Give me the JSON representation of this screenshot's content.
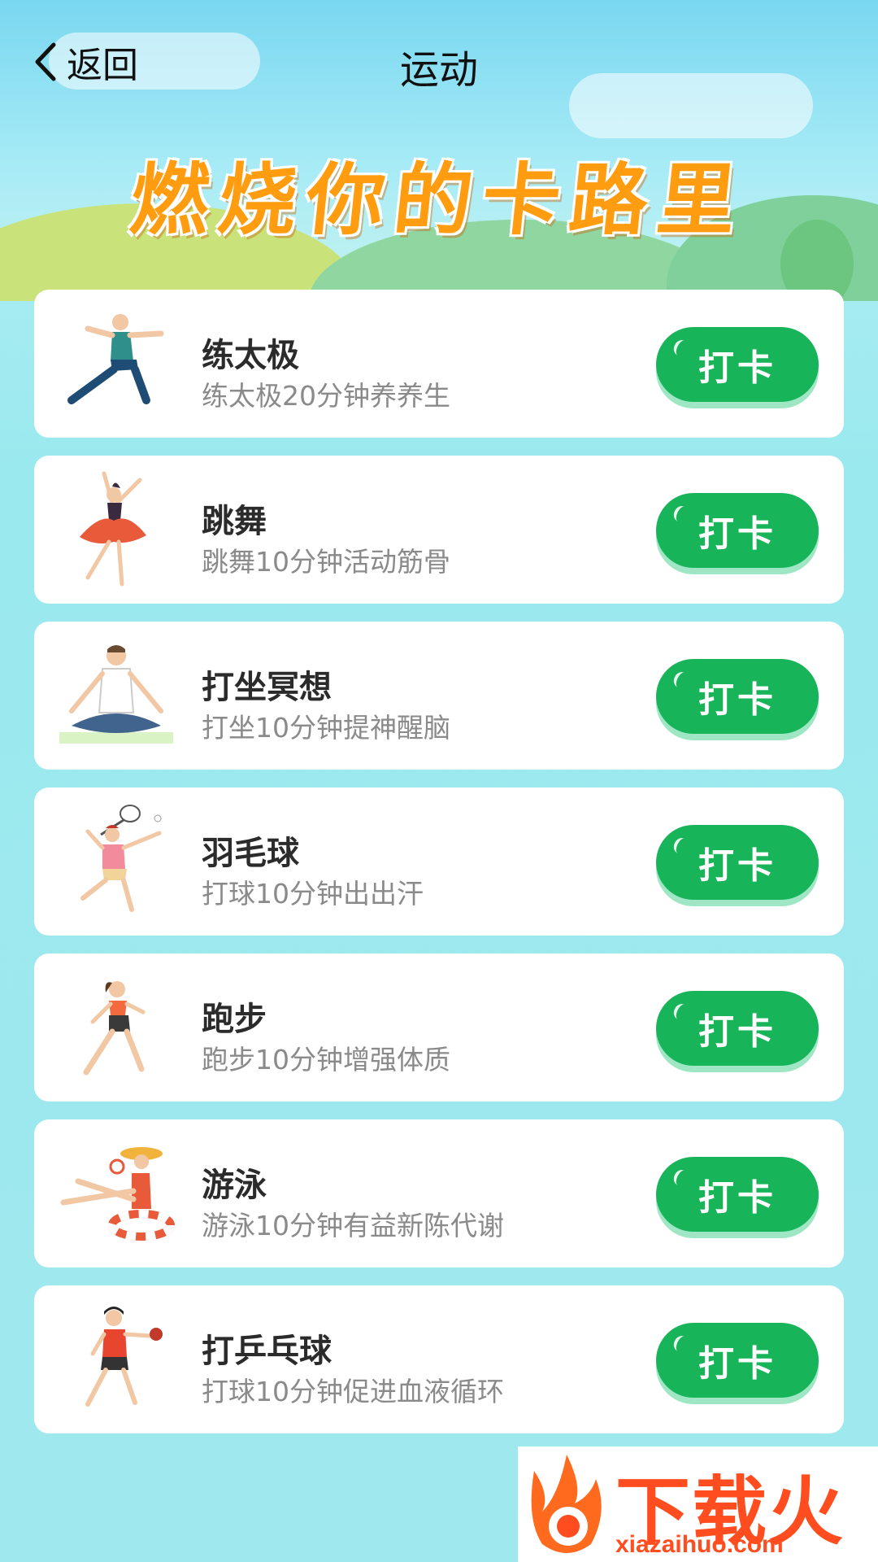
{
  "nav": {
    "back_label": "返回",
    "title": "运动"
  },
  "hero": {
    "headline": "燃烧你的卡路里"
  },
  "items": [
    {
      "title": "练太极",
      "desc": "练太极20分钟养养生",
      "button": "打卡",
      "icon": "tai-chi-figure"
    },
    {
      "title": "跳舞",
      "desc": "跳舞10分钟活动筋骨",
      "button": "打卡",
      "icon": "dancer-figure"
    },
    {
      "title": "打坐冥想",
      "desc": "打坐10分钟提神醒脑",
      "button": "打卡",
      "icon": "meditation-figure"
    },
    {
      "title": "羽毛球",
      "desc": "打球10分钟出出汗",
      "button": "打卡",
      "icon": "badminton-figure"
    },
    {
      "title": "跑步",
      "desc": "跑步10分钟增强体质",
      "button": "打卡",
      "icon": "runner-figure"
    },
    {
      "title": "游泳",
      "desc": "游泳10分钟有益新陈代谢",
      "button": "打卡",
      "icon": "swimmer-figure"
    },
    {
      "title": "打乒乓球",
      "desc": "打球10分钟促进血液循环",
      "button": "打卡",
      "icon": "ping-pong-figure"
    }
  ],
  "watermark": {
    "brand": "下载火",
    "url": "xiazaihuo.com"
  },
  "colors": {
    "accent": "#17b45a",
    "headline": "#ff9c0f",
    "background": "#9fe8ee"
  }
}
